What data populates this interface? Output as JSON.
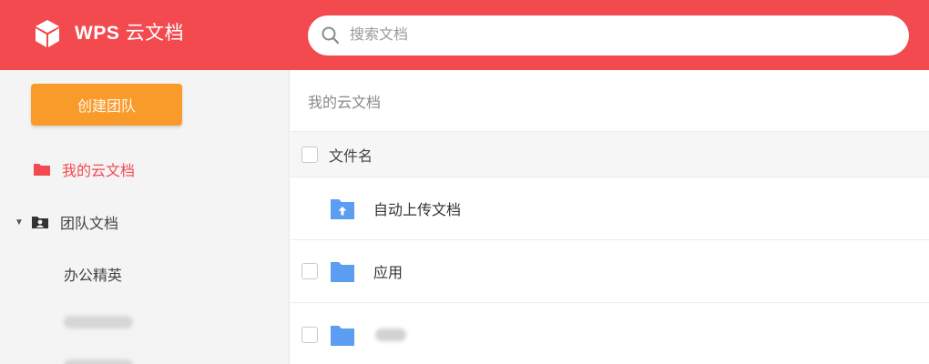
{
  "app": {
    "logo_brand": "WPS",
    "logo_suffix": "云文档"
  },
  "search": {
    "placeholder": "搜索文档"
  },
  "sidebar": {
    "create_team_label": "创建团队",
    "items": [
      {
        "label": "我的云文档",
        "icon": "folder-icon",
        "active": true
      },
      {
        "label": "团队文档",
        "icon": "team-folder-icon",
        "expanded": true,
        "caret": "▼"
      },
      {
        "label": "办公精英"
      }
    ]
  },
  "main": {
    "breadcrumb": "我的云文档",
    "column_name": "文件名",
    "files": [
      {
        "name": "自动上传文档",
        "icon": "upload-folder-icon"
      },
      {
        "name": "应用",
        "icon": "folder-icon"
      }
    ]
  },
  "colors": {
    "topbar": "#f24a4f",
    "create_button": "#f99b2a",
    "folder": "#5b9df1",
    "active_text": "#f24a4f"
  }
}
